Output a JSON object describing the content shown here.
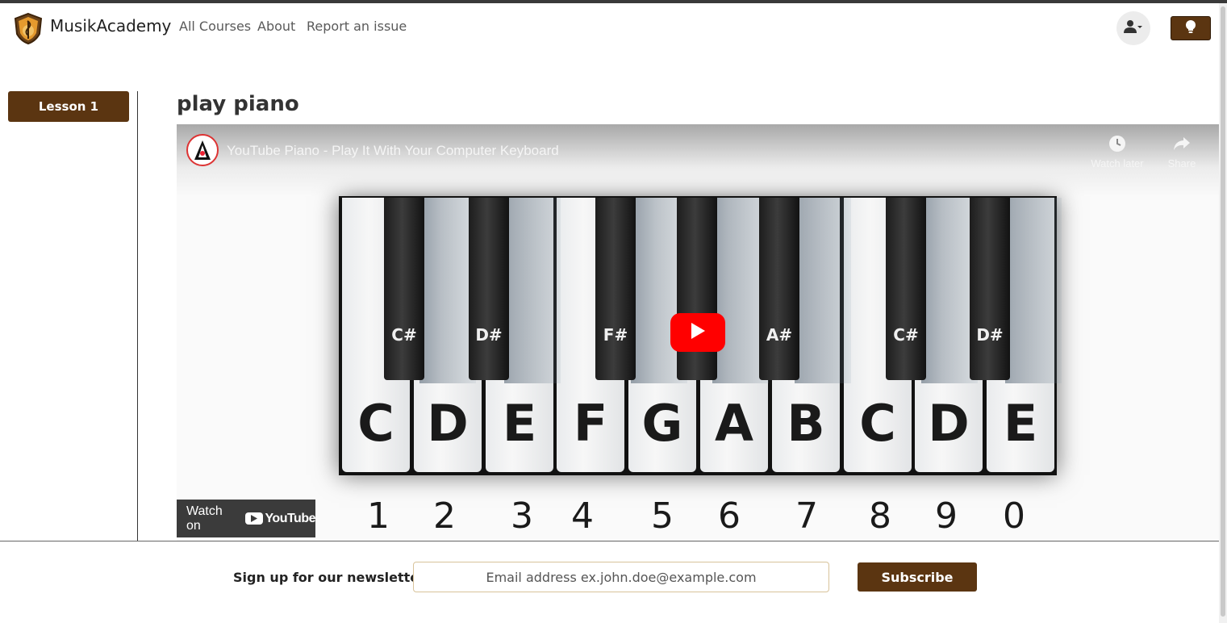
{
  "nav": {
    "brand": "MusikAcademy",
    "links": [
      "All Courses",
      "About",
      "Report an issue"
    ],
    "user_icon": "user-icon",
    "theme_icon": "lightbulb-icon"
  },
  "sidebar": {
    "lessons": [
      "Lesson 1"
    ]
  },
  "main": {
    "title": "play piano",
    "video": {
      "title": "YouTube Piano - Play It With Your Computer Keyboard",
      "watch_later": "Watch later",
      "share": "Share",
      "watch_on": "Watch on",
      "youtube": "YouTube",
      "white_keys": [
        "C",
        "D",
        "E",
        "F",
        "G",
        "A",
        "B",
        "C",
        "D",
        "E"
      ],
      "black_keys": [
        "C#",
        "D#",
        "",
        "F#",
        "",
        "A#",
        "",
        "C#",
        "D#"
      ],
      "digits": [
        "1",
        "2",
        "3",
        "4",
        "5",
        "6",
        "7",
        "8",
        "9",
        "0"
      ]
    }
  },
  "footer": {
    "newsletter_label": "Sign up for our newsletter",
    "email_placeholder": "Email address ex.john.doe@example.com",
    "subscribe_label": "Subscribe"
  },
  "colors": {
    "brand_brown": "#5b3511",
    "youtube_red": "#ff0000"
  }
}
